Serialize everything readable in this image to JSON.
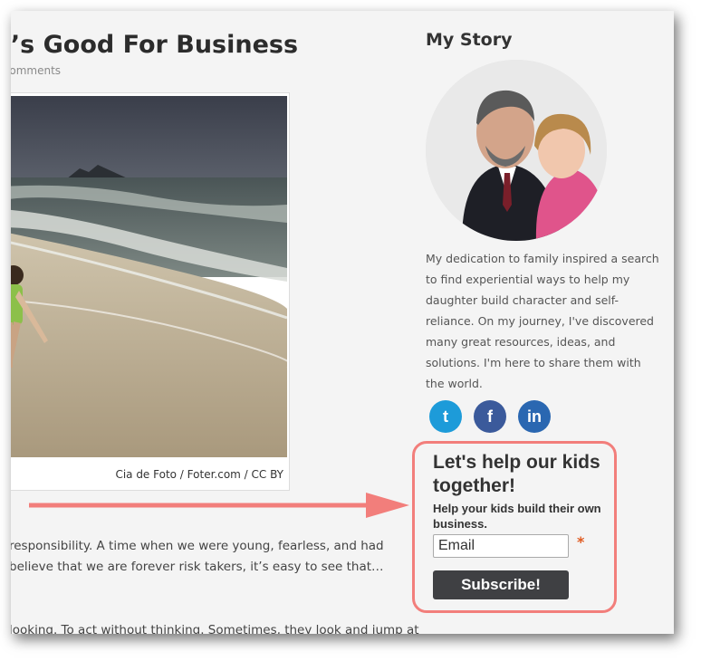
{
  "post": {
    "title": "t’s Good For Business",
    "meta": "Comments",
    "photo_credit": "Cia de Foto / Foter.com / CC BY",
    "excerpt_lines": [
      "responsibility. A time when we were young, fearless, and had",
      "believe that we are forever risk takers, it’s easy to see that…"
    ],
    "excerpt_partial": "looking. To act without thinking. Sometimes, they look and jump at"
  },
  "sidebar": {
    "title": "My Story",
    "bio": "My dedication to family inspired a search to find experiential ways to help my daughter build character and self-reliance. On my journey, I've discovered many great resources, ideas, and solutions. I'm here to share them with the world.",
    "social": {
      "twitter_glyph": "t",
      "facebook_glyph": "f",
      "linkedin_glyph": "in"
    }
  },
  "optin": {
    "heading": "Let's help our kids together!",
    "subheading": "Help your kids build their own business.",
    "email_placeholder": "Email",
    "required_mark": "*",
    "button_label": "Subscribe!"
  },
  "colors": {
    "accent_border": "#f27e7b",
    "arrow": "#f27e7b",
    "twitter": "#1d9bd9",
    "facebook": "#3b5a9b",
    "linkedin": "#2a67b1",
    "button": "#3f4043"
  },
  "icons": [
    "twitter-icon",
    "facebook-icon",
    "linkedin-icon",
    "arrow-right-icon"
  ]
}
